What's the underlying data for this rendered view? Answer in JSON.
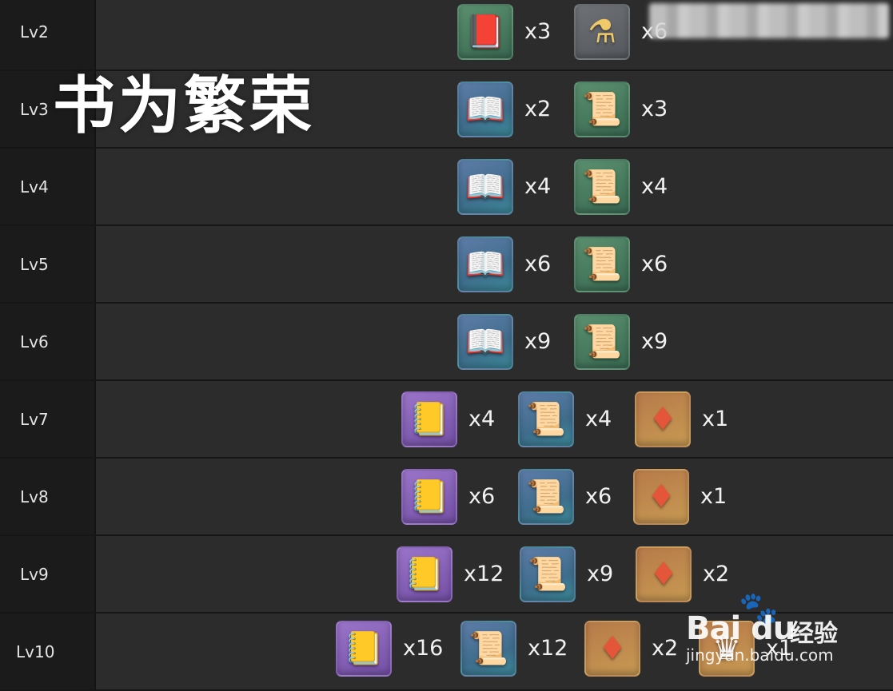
{
  "title_overlay": "书为繁荣",
  "watermark": {
    "logo": "Bai du",
    "label": "经验",
    "url": "jingyan.baidu.com"
  },
  "rows": [
    {
      "level": "Lv2",
      "mats": [
        {
          "icon": "brown-book-icon",
          "qty": "x3"
        },
        {
          "icon": "potion-bottle-icon",
          "qty": "x6"
        }
      ]
    },
    {
      "level": "Lv3",
      "mats": [
        {
          "icon": "silver-book-icon",
          "qty": "x2"
        },
        {
          "icon": "green-scroll-icon",
          "qty": "x3"
        }
      ]
    },
    {
      "level": "Lv4",
      "mats": [
        {
          "icon": "silver-book-icon",
          "qty": "x4"
        },
        {
          "icon": "green-scroll-icon",
          "qty": "x4"
        }
      ]
    },
    {
      "level": "Lv5",
      "mats": [
        {
          "icon": "silver-book-icon",
          "qty": "x6"
        },
        {
          "icon": "green-scroll-icon",
          "qty": "x6"
        }
      ]
    },
    {
      "level": "Lv6",
      "mats": [
        {
          "icon": "silver-book-icon",
          "qty": "x9"
        },
        {
          "icon": "green-scroll-icon",
          "qty": "x9"
        }
      ]
    },
    {
      "level": "Lv7",
      "mats": [
        {
          "icon": "gold-book-icon",
          "qty": "x4"
        },
        {
          "icon": "gold-scroll-icon",
          "qty": "x4"
        },
        {
          "icon": "red-crystal-icon",
          "qty": "x1"
        }
      ]
    },
    {
      "level": "Lv8",
      "mats": [
        {
          "icon": "gold-book-icon",
          "qty": "x6"
        },
        {
          "icon": "gold-scroll-icon",
          "qty": "x6"
        },
        {
          "icon": "red-crystal-icon",
          "qty": "x1"
        }
      ]
    },
    {
      "level": "Lv9",
      "mats": [
        {
          "icon": "gold-book-icon",
          "qty": "x12"
        },
        {
          "icon": "gold-scroll-icon",
          "qty": "x9"
        },
        {
          "icon": "red-crystal-icon",
          "qty": "x2"
        }
      ]
    },
    {
      "level": "Lv10",
      "mats": [
        {
          "icon": "gold-book-icon",
          "qty": "x16"
        },
        {
          "icon": "gold-scroll-icon",
          "qty": "x12"
        },
        {
          "icon": "red-crystal-icon",
          "qty": "x2"
        },
        {
          "icon": "crown-icon",
          "qty": "x1"
        }
      ]
    }
  ]
}
